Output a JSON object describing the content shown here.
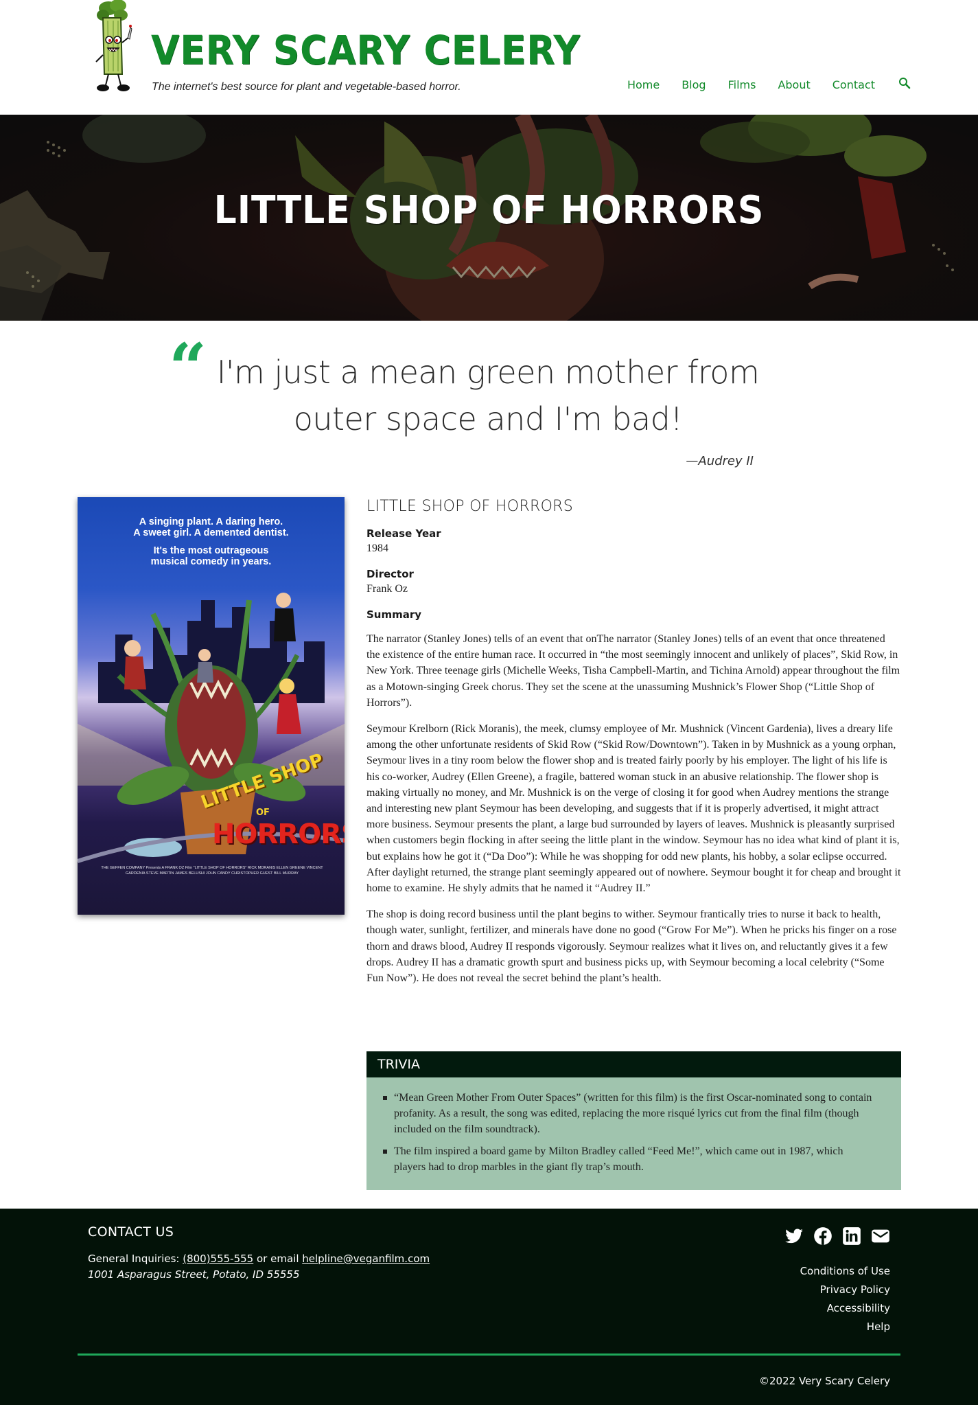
{
  "site": {
    "logo_title": "VERY SCARY CELERY",
    "tagline": "The internet's best source for plant and vegetable-based horror."
  },
  "nav": {
    "items": [
      {
        "label": "Home"
      },
      {
        "label": "Blog"
      },
      {
        "label": "Films"
      },
      {
        "label": "About"
      },
      {
        "label": "Contact"
      }
    ],
    "search_icon": "search-icon"
  },
  "hero": {
    "title": "LITTLE SHOP OF HORRORS"
  },
  "quote": {
    "mark": "“",
    "text": "I'm just a mean green mother from outer space and I'm bad!",
    "cite": "—Audrey II"
  },
  "poster": {
    "tagline_1": "A singing plant. A daring hero.",
    "tagline_2": "A sweet girl. A demented dentist.",
    "tagline_3": "It's the most outrageous",
    "tagline_4": "musical comedy in years.",
    "title_top": "LITTLE SHOP",
    "title_mid": "OF",
    "title_bottom": "HORRORS",
    "credits": "THE GEFFEN COMPANY Presents A FRANK OZ Film \"LITTLE SHOP OF HORRORS\" RICK MORANIS ELLEN GREENE VINCENT GARDENIA STEVE MARTIN JAMES BELUSHI JOHN CANDY CHRISTOPHER GUEST BILL MURRAY"
  },
  "film": {
    "title": "LITTLE SHOP OF HORRORS",
    "release_label": "Release Year",
    "release_value": "1984",
    "director_label": "Director",
    "director_value": "Frank Oz",
    "summary_label": "Summary",
    "summary": [
      "The narrator (Stanley Jones) tells of an event that onThe narrator (Stanley Jones) tells of an event that once threatened the existence of the entire human race. It occurred in “the most seemingly innocent and unlikely of places”, Skid Row, in New York. Three teenage girls (Michelle Weeks, Tisha Campbell-Martin, and Tichina Arnold) appear throughout the film as a Motown-singing Greek chorus. They set the scene at the unassuming Mushnick’s Flower Shop (“Little Shop of Horrors”).",
      "Seymour Krelborn (Rick Moranis), the meek, clumsy employee of Mr. Mushnick (Vincent Gardenia), lives a dreary life among the other unfortunate residents of Skid Row (“Skid Row/Downtown”). Taken in by Mushnick as a young orphan, Seymour lives in a tiny room below the flower shop and is treated fairly poorly by his employer. The light of his life is his co-worker, Audrey (Ellen Greene), a fragile, battered woman stuck in an abusive relationship. The flower shop is making virtually no money, and Mr. Mushnick is on the verge of closing it for good when Audrey mentions the strange and interesting new plant Seymour has been developing, and suggests that if it is properly advertised, it might attract more business. Seymour presents the plant, a large bud surrounded by layers of leaves. Mushnick is pleasantly surprised when customers begin flocking in after seeing the little plant in the window. Seymour has no idea what kind of plant it is, but explains how he got it (“Da Doo”): While he was shopping for odd new plants, his hobby, a solar eclipse occurred. After daylight returned, the strange plant seemingly appeared out of nowhere. Seymour bought it for cheap and brought it home to examine. He shyly admits that he named it “Audrey II.”",
      "The shop is doing record business until the plant begins to wither. Seymour frantically tries to nurse it back to health, though water, sunlight, fertilizer, and minerals have done no good (“Grow For Me”). When he pricks his finger on a rose thorn and draws blood, Audrey II responds vigorously. Seymour realizes what it lives on, and reluctantly gives it a few drops. Audrey II has a dramatic growth spurt and business picks up, with Seymour becoming a local celebrity (“Some Fun Now”). He does not reveal the secret behind the plant’s health."
    ]
  },
  "trivia": {
    "heading": "TRIVIA",
    "items": [
      "“Mean Green Mother From Outer Spaces” (written for this film) is the first Oscar-nominated song to contain profanity. As a result, the song was edited, replacing the more risqué lyrics cut from the final film (though included on the film soundtrack).",
      "The film inspired a board game by Milton Bradley called “Feed Me!”, which came out in 1987, which players had to drop marbles in the giant fly trap’s mouth."
    ]
  },
  "footer": {
    "heading": "CONTACT US",
    "inquiries_prefix": "General Inquiries: ",
    "phone": "(800)555-555",
    "inquiries_mid": " or email ",
    "email": "helpline@veganfilm.com",
    "address": "1001 Asparagus Street, Potato, ID 55555",
    "social_icons": [
      "twitter-icon",
      "facebook-icon",
      "linkedin-icon",
      "mail-icon"
    ],
    "links": [
      {
        "label": "Conditions of Use"
      },
      {
        "label": "Privacy Policy"
      },
      {
        "label": "Accessibility"
      },
      {
        "label": "Help"
      }
    ],
    "copyright": "©2022 Very Scary Celery"
  },
  "colors": {
    "brand_green": "#128a2a",
    "accent_green": "#1fa85a",
    "footer_bg": "#031208",
    "trivia_bg": "#a0c4ae",
    "trivia_head_bg": "#021a0d"
  }
}
